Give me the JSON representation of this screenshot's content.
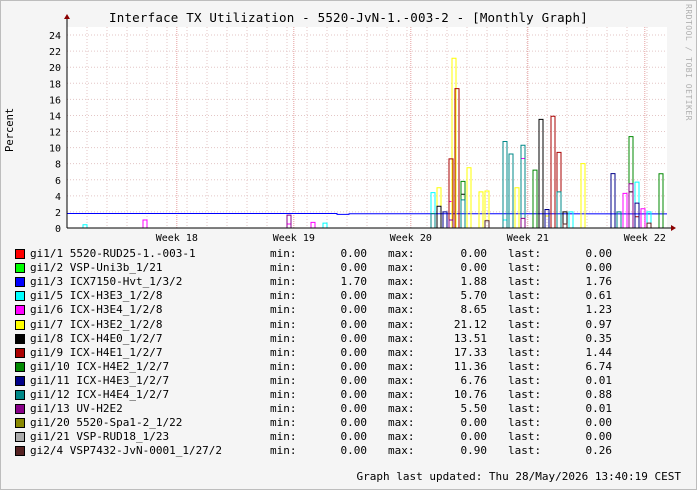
{
  "title": "Interface TX Utilization - 5520-JvN-1.-003-2 - [Monthly Graph]",
  "watermark": "RRDTOOL / TOBI OETIKER",
  "footer": "Graph last updated: Thu 28/May/2026 13:40:19 CEST",
  "legend_labels": {
    "min": "min:",
    "max": "max:",
    "last": "last:"
  },
  "chart_data": {
    "type": "line",
    "ylabel": "Percent",
    "ylim": [
      0,
      25
    ],
    "yticks": [
      0,
      2,
      4,
      6,
      8,
      10,
      12,
      14,
      16,
      18,
      20,
      22,
      24
    ],
    "x_ticks": [
      "Week 18",
      "Week 19",
      "Week 20",
      "Week 21",
      "Week 22"
    ],
    "grid": true,
    "series": [
      {
        "name": "gi1/1 5520-RUD25-1.-003-1",
        "color": "#ff0000",
        "min": "0.00",
        "max": "0.00",
        "last": "0.00",
        "spikes": []
      },
      {
        "name": "gi1/2 VSP-Uni3b_1/21",
        "color": "#00ff00",
        "min": "0.00",
        "max": "0.00",
        "last": "0.00",
        "spikes": []
      },
      {
        "name": "gi1/3 ICX7150-Hvt_1/3/2",
        "color": "#0000ff",
        "min": "1.70",
        "max": "1.88",
        "last": "1.76",
        "spikes": []
      },
      {
        "name": "gi1/5 ICX-H3E3_1/2/8",
        "color": "#00ffff",
        "min": "0.00",
        "max": "5.70",
        "last": "0.61",
        "spikes": [
          [
            0.03,
            0.4
          ],
          [
            0.43,
            0.6
          ],
          [
            0.61,
            4.4
          ],
          [
            0.73,
            1.0
          ],
          [
            0.84,
            2.0
          ],
          [
            0.95,
            5.7
          ],
          [
            0.97,
            2.0
          ]
        ]
      },
      {
        "name": "gi1/6 ICX-H3E4_1/2/8",
        "color": "#ff00ff",
        "min": "0.00",
        "max": "8.65",
        "last": "1.23",
        "spikes": [
          [
            0.13,
            1.0
          ],
          [
            0.37,
            0.5
          ],
          [
            0.41,
            0.7
          ],
          [
            0.64,
            3.3
          ],
          [
            0.76,
            8.65
          ],
          [
            0.93,
            4.3
          ],
          [
            0.96,
            2.4
          ]
        ]
      },
      {
        "name": "gi1/7 ICX-H3E2_1/2/8",
        "color": "#ffff00",
        "min": "0.00",
        "max": "21.12",
        "last": "0.97",
        "spikes": [
          [
            0.62,
            5.0
          ],
          [
            0.645,
            21.12
          ],
          [
            0.67,
            7.5
          ],
          [
            0.69,
            4.5
          ],
          [
            0.7,
            4.6
          ],
          [
            0.75,
            5.0
          ],
          [
            0.8,
            1.5
          ],
          [
            0.86,
            8.0
          ]
        ]
      },
      {
        "name": "gi1/8 ICX-H4E0_1/2/7",
        "color": "#000000",
        "min": "0.00",
        "max": "13.51",
        "last": "0.35",
        "spikes": [
          [
            0.62,
            2.7
          ],
          [
            0.66,
            4.2
          ],
          [
            0.79,
            13.51
          ],
          [
            0.83,
            2.0
          ],
          [
            0.94,
            4.5
          ]
        ]
      },
      {
        "name": "gi1/9 ICX-H4E1_1/2/7",
        "color": "#aa0000",
        "min": "0.00",
        "max": "17.33",
        "last": "1.44",
        "spikes": [
          [
            0.64,
            8.6
          ],
          [
            0.65,
            17.33
          ],
          [
            0.81,
            13.9
          ],
          [
            0.82,
            9.4
          ],
          [
            0.95,
            1.4
          ]
        ]
      },
      {
        "name": "gi1/10 ICX-H4E2_1/2/7",
        "color": "#008800",
        "min": "0.00",
        "max": "11.36",
        "last": "6.74",
        "spikes": [
          [
            0.66,
            5.8
          ],
          [
            0.78,
            7.2
          ],
          [
            0.94,
            11.36
          ],
          [
            0.99,
            6.74
          ]
        ]
      },
      {
        "name": "gi1/11 ICX-H4E3_1/2/7",
        "color": "#000088",
        "min": "0.00",
        "max": "6.76",
        "last": "0.01",
        "spikes": [
          [
            0.63,
            2.0
          ],
          [
            0.8,
            2.3
          ],
          [
            0.91,
            6.76
          ],
          [
            0.95,
            3.1
          ]
        ]
      },
      {
        "name": "gi1/12 ICX-H4E4_1/2/7",
        "color": "#008888",
        "min": "0.00",
        "max": "10.76",
        "last": "0.88",
        "spikes": [
          [
            0.61,
            1.8
          ],
          [
            0.66,
            3.5
          ],
          [
            0.73,
            10.76
          ],
          [
            0.74,
            9.2
          ],
          [
            0.76,
            10.3
          ],
          [
            0.82,
            4.5
          ],
          [
            0.92,
            2.0
          ]
        ]
      },
      {
        "name": "gi1/13 UV-H2E2",
        "color": "#880088",
        "min": "0.00",
        "max": "5.50",
        "last": "0.01",
        "spikes": [
          [
            0.37,
            1.6
          ],
          [
            0.64,
            1.0
          ],
          [
            0.76,
            1.2
          ],
          [
            0.94,
            5.5
          ]
        ]
      },
      {
        "name": "gi1/20 5520-Spa1-2_1/22",
        "color": "#888800",
        "min": "0.00",
        "max": "0.00",
        "last": "0.00",
        "spikes": []
      },
      {
        "name": "gi1/21 VSP-RUD18_1/23",
        "color": "#aaaaaa",
        "min": "0.00",
        "max": "0.00",
        "last": "0.00",
        "spikes": []
      },
      {
        "name": "gi2/4 VSP7432-JvN-0001_1/27/2",
        "color": "#552222",
        "min": "0.00",
        "max": "0.90",
        "last": "0.26",
        "spikes": [
          [
            0.7,
            0.9
          ],
          [
            0.83,
            0.5
          ],
          [
            0.97,
            0.6
          ]
        ]
      }
    ]
  }
}
